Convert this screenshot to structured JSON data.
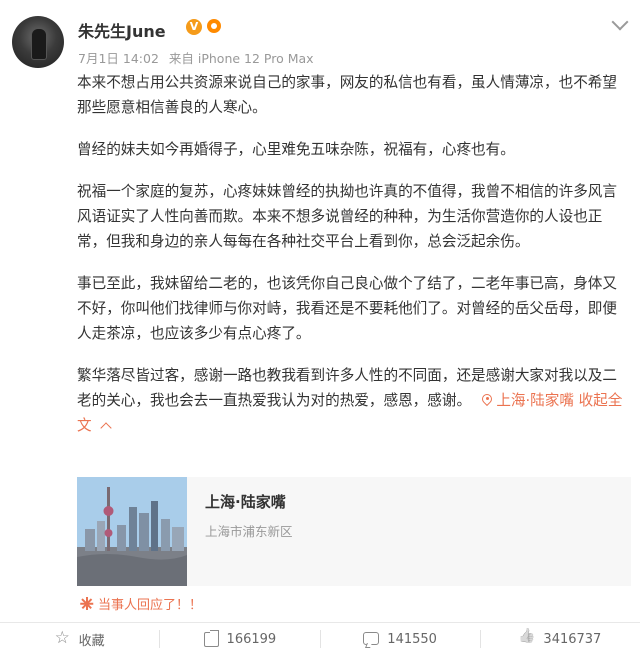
{
  "post": {
    "username": "朱先生June",
    "verified_badge": "V",
    "date": "7月1日 14:02",
    "source": "来自 iPhone 12 Pro Max",
    "paragraphs": [
      "本来不想占用公共资源来说自己的家事，网友的私信也有看，虽人情薄凉，也不希望那些愿意相信善良的人寒心。",
      "曾经的妹夫如今再婚得子，心里难免五味杂陈，祝福有，心疼也有。",
      "祝福一个家庭的复苏，心疼妹妹曾经的执拗也许真的不值得，我曾不相信的许多风言风语证实了人性向善而欺。本来不想多说曾经的种种，为生活你营造你的人设也正常，但我和身边的亲人每每在各种社交平台上看到你，总会泛起余伤。",
      "事已至此，我妹留给二老的，也该凭你自己良心做个了结了，二老年事已高，身体又不好，你叫他们找律师与你对峙，我看还是不要耗他们了。对曾经的岳父岳母，即便人走茶凉，也应该多少有点心疼了。"
    ],
    "last_paragraph": "繁华落尽皆过客，感谢一路也教我看到许多人性的不同面，还是感谢大家对我以及二老的关心，我也会去一直热爱我认为对的热爱，感恩，感谢。",
    "location_inline": "上海·陆家嘴",
    "collapse_label": "收起全文",
    "location_card": {
      "title": "上海·陆家嘴",
      "subtitle": "上海市浦东新区"
    },
    "repost_label": "当事人回应了！！"
  },
  "actions": {
    "favorite_label": "收藏",
    "repost_count": "166199",
    "comment_count": "141550",
    "like_count": "3416737"
  },
  "colors": {
    "accent": "#eb7350",
    "badge_orange": "#f59b1a",
    "meta_gray": "#999999"
  }
}
